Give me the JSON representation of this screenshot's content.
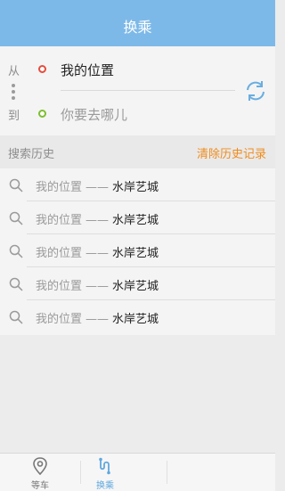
{
  "header": {
    "title": "换乘"
  },
  "route": {
    "from_label": "从",
    "to_label": "到",
    "from_value": "我的位置",
    "to_placeholder": "你要去哪儿",
    "swap_icon": "refresh-swap-icon",
    "from_dot_color": "#e74c3c",
    "to_dot_color": "#7cbf2e"
  },
  "history": {
    "title": "搜索历史",
    "clear_label": "清除历史记录",
    "items": [
      {
        "from": "我的位置",
        "sep": "——",
        "to": "水岸艺城"
      },
      {
        "from": "我的位置",
        "sep": "——",
        "to": "水岸艺城"
      },
      {
        "from": "我的位置",
        "sep": "——",
        "to": "水岸艺城"
      },
      {
        "from": "我的位置",
        "sep": "——",
        "to": "水岸艺城"
      },
      {
        "from": "我的位置",
        "sep": "——",
        "to": "水岸艺城"
      }
    ]
  },
  "tabs": [
    {
      "label": "等车",
      "icon": "location-pin-icon",
      "active": false
    },
    {
      "label": "换乘",
      "icon": "route-icon",
      "active": true
    },
    {
      "label": "",
      "icon": "",
      "active": false
    }
  ],
  "colors": {
    "accent": "#7db9e8",
    "clear": "#f08c1c",
    "tab_active": "#5fa8de"
  }
}
